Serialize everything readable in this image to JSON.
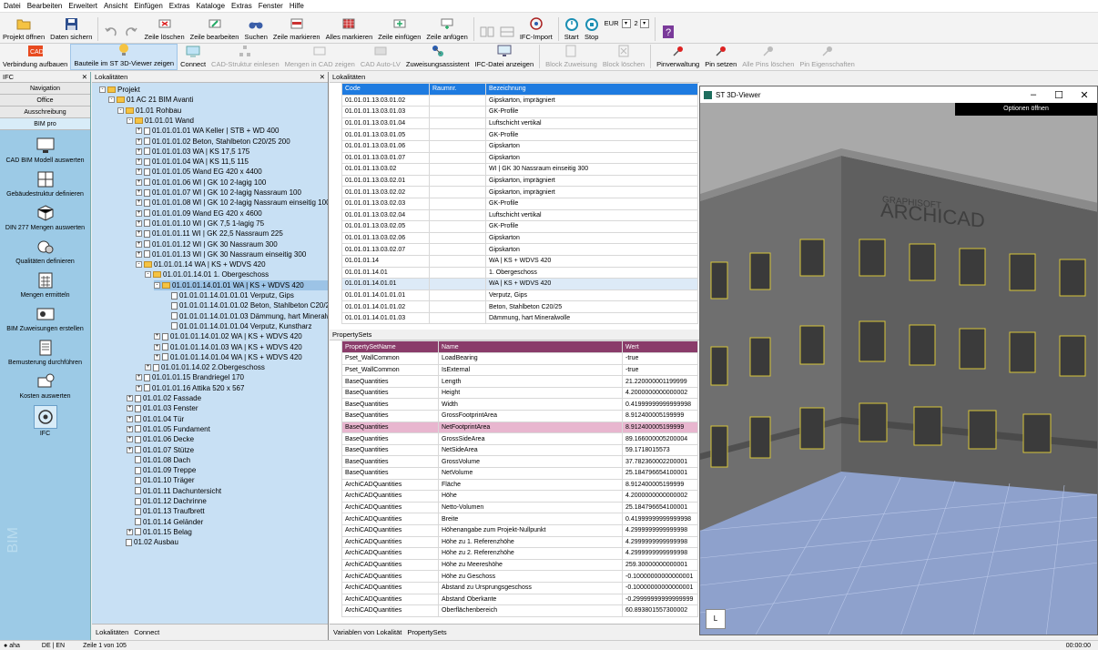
{
  "menu": [
    "Datei",
    "Bearbeiten",
    "Erweitert",
    "Ansicht",
    "Einfügen",
    "Extras",
    "Kataloge",
    "Extras",
    "Fenster",
    "Hilfe"
  ],
  "toolbar1": {
    "projekt_oeffnen": "Projekt öffnen",
    "daten_sichern": "Daten sichern",
    "zeile_loeschen": "Zeile löschen",
    "zeile_bearbeiten": "Zeile bearbeiten",
    "suchen": "Suchen",
    "zeile_markieren": "Zeile markieren",
    "alles_markieren": "Alles markieren",
    "zeile_einfuegen": "Zeile einfügen",
    "zeile_anfuegen": "Zeile anfügen",
    "ifc_import": "IFC-Import",
    "start": "Start",
    "stop": "Stop",
    "currency": "EUR",
    "decimals": "2"
  },
  "toolbar2": {
    "verbindung": "Verbindung aufbauen",
    "bauteile_3d": "Bauteile im ST 3D-Viewer zeigen",
    "connect": "Connect",
    "cad_struktur": "CAD-Struktur einlesen",
    "mengen_cad": "Mengen in CAD zeigen",
    "cad_auto_lv": "CAD Auto-LV",
    "zuweisungsassistent": "Zuweisungsassistent",
    "ifc_datei": "IFC-Datei anzeigen",
    "block_zuweisung": "Block Zuweisung",
    "block_loeschen": "Block löschen",
    "pinverwaltung": "Pinverwaltung",
    "pin_setzen": "Pin setzen",
    "alle_pins_loeschen": "Alle Pins löschen",
    "pin_eigenschaften": "Pin Eigenschaften"
  },
  "leftpanel": {
    "title": "IFC",
    "tabs": [
      "Navigation",
      "Office",
      "Ausschreibung",
      "BIM pro"
    ],
    "items": [
      "CAD BIM Modell auswerten",
      "Gebäudestruktur definieren",
      "DIN 277 Mengen auswerten",
      "Qualitäten definieren",
      "Mengen ermitteln",
      "BIM Zuweisungen erstellen",
      "Bemusterung durchführen",
      "Kosten auswerten",
      "IFC"
    ],
    "vertical_text": "BIM"
  },
  "tree": {
    "title": "Lokalitäten",
    "tabs": [
      "Lokalitäten",
      "Connect"
    ],
    "nodes": [
      {
        "d": 0,
        "t": "Projekt",
        "k": "fold",
        "pm": "-"
      },
      {
        "d": 1,
        "t": "01  AC 21 BIM Avanti",
        "k": "fold",
        "pm": "-"
      },
      {
        "d": 2,
        "t": "01.01  Rohbau",
        "k": "fold",
        "pm": "-"
      },
      {
        "d": 3,
        "t": "01.01.01  Wand",
        "k": "fold",
        "pm": "-"
      },
      {
        "d": 4,
        "t": "01.01.01.01  WA Keller | STB + WD 400",
        "k": "doc",
        "pm": "+"
      },
      {
        "d": 4,
        "t": "01.01.01.02  Beton, Stahlbeton C20/25 200",
        "k": "doc",
        "pm": "+"
      },
      {
        "d": 4,
        "t": "01.01.01.03  WA | KS 17,5 175",
        "k": "doc",
        "pm": "+"
      },
      {
        "d": 4,
        "t": "01.01.01.04  WA | KS 11,5 115",
        "k": "doc",
        "pm": "+"
      },
      {
        "d": 4,
        "t": "01.01.01.05  Wand EG 420 x 4400",
        "k": "doc",
        "pm": "+"
      },
      {
        "d": 4,
        "t": "01.01.01.06  WI | GK 10 2-lagig 100",
        "k": "doc",
        "pm": "+"
      },
      {
        "d": 4,
        "t": "01.01.01.07  WI | GK 10 2-lagig Nassraum 100",
        "k": "doc",
        "pm": "+"
      },
      {
        "d": 4,
        "t": "01.01.01.08  WI | GK 10 2-lagig Nassraum einseitig 100",
        "k": "doc",
        "pm": "+"
      },
      {
        "d": 4,
        "t": "01.01.01.09  Wand EG 420 x 4600",
        "k": "doc",
        "pm": "+"
      },
      {
        "d": 4,
        "t": "01.01.01.10  WI | GK 7,5 1-lagig 75",
        "k": "doc",
        "pm": "+"
      },
      {
        "d": 4,
        "t": "01.01.01.11  WI | GK 22,5 Nassraum 225",
        "k": "doc",
        "pm": "+"
      },
      {
        "d": 4,
        "t": "01.01.01.12  WI | GK 30 Nassraum 300",
        "k": "doc",
        "pm": "+"
      },
      {
        "d": 4,
        "t": "01.01.01.13  WI | GK 30 Nassraum einseitig 300",
        "k": "doc",
        "pm": "+"
      },
      {
        "d": 4,
        "t": "01.01.01.14  WA | KS + WDVS 420",
        "k": "fold",
        "pm": "-"
      },
      {
        "d": 5,
        "t": "01.01.01.14.01  1. Obergeschoss",
        "k": "fold",
        "pm": "-"
      },
      {
        "d": 6,
        "t": "01.01.01.14.01.01  WA | KS + WDVS 420",
        "k": "fold",
        "pm": "-",
        "sel": true
      },
      {
        "d": 7,
        "t": "01.01.01.14.01.01.01  Verputz, Gips",
        "k": "doc",
        "pm": ""
      },
      {
        "d": 7,
        "t": "01.01.01.14.01.01.02  Beton, Stahlbeton C20/25",
        "k": "doc",
        "pm": ""
      },
      {
        "d": 7,
        "t": "01.01.01.14.01.01.03  Dämmung, hart Mineralwo",
        "k": "doc",
        "pm": ""
      },
      {
        "d": 7,
        "t": "01.01.01.14.01.01.04  Verputz, Kunstharz",
        "k": "doc",
        "pm": ""
      },
      {
        "d": 6,
        "t": "01.01.01.14.01.02  WA | KS + WDVS 420",
        "k": "doc",
        "pm": "+"
      },
      {
        "d": 6,
        "t": "01.01.01.14.01.03  WA | KS + WDVS 420",
        "k": "doc",
        "pm": "+"
      },
      {
        "d": 6,
        "t": "01.01.01.14.01.04  WA | KS + WDVS 420",
        "k": "doc",
        "pm": "+"
      },
      {
        "d": 5,
        "t": "01.01.01.14.02  2.Obergeschoss",
        "k": "doc",
        "pm": "+"
      },
      {
        "d": 4,
        "t": "01.01.01.15  Brandriegel 170",
        "k": "doc",
        "pm": "+"
      },
      {
        "d": 4,
        "t": "01.01.01.16  Attika 520 x 567",
        "k": "doc",
        "pm": "+"
      },
      {
        "d": 3,
        "t": "01.01.02  Fassade",
        "k": "doc",
        "pm": "+"
      },
      {
        "d": 3,
        "t": "01.01.03  Fenster",
        "k": "doc",
        "pm": "+"
      },
      {
        "d": 3,
        "t": "01.01.04  Tür",
        "k": "doc",
        "pm": "+"
      },
      {
        "d": 3,
        "t": "01.01.05  Fundament",
        "k": "doc",
        "pm": "+"
      },
      {
        "d": 3,
        "t": "01.01.06  Decke",
        "k": "doc",
        "pm": "+"
      },
      {
        "d": 3,
        "t": "01.01.07  Stütze",
        "k": "doc",
        "pm": "+"
      },
      {
        "d": 3,
        "t": "01.01.08  Dach",
        "k": "doc",
        "pm": ""
      },
      {
        "d": 3,
        "t": "01.01.09  Treppe",
        "k": "doc",
        "pm": ""
      },
      {
        "d": 3,
        "t": "01.01.10  Träger",
        "k": "doc",
        "pm": ""
      },
      {
        "d": 3,
        "t": "01.01.11  Dachuntersicht",
        "k": "doc",
        "pm": ""
      },
      {
        "d": 3,
        "t": "01.01.12  Dachrinne",
        "k": "doc",
        "pm": ""
      },
      {
        "d": 3,
        "t": "01.01.13  Traufbrett",
        "k": "doc",
        "pm": ""
      },
      {
        "d": 3,
        "t": "01.01.14  Geländer",
        "k": "doc",
        "pm": ""
      },
      {
        "d": 3,
        "t": "01.01.15  Belag",
        "k": "doc",
        "pm": "+"
      },
      {
        "d": 2,
        "t": "01.02  Ausbau",
        "k": "doc",
        "pm": ""
      }
    ]
  },
  "lokalitaeten": {
    "title": "Lokalitäten",
    "columns": [
      "Code",
      "Raumnr.",
      "Bezeichnung"
    ],
    "rows": [
      [
        "01.01.01.13.03.01.02",
        "",
        "Gipskarton, imprägniert"
      ],
      [
        "01.01.01.13.03.01.03",
        "",
        "GK-Profile"
      ],
      [
        "01.01.01.13.03.01.04",
        "",
        "Luftschicht vertikal"
      ],
      [
        "01.01.01.13.03.01.05",
        "",
        "GK-Profile"
      ],
      [
        "01.01.01.13.03.01.06",
        "",
        "Gipskarton"
      ],
      [
        "01.01.01.13.03.01.07",
        "",
        "Gipskarton"
      ],
      [
        "01.01.01.13.03.02",
        "",
        "WI | GK 30 Nassraum einseitig 300"
      ],
      [
        "01.01.01.13.03.02.01",
        "",
        "Gipskarton, imprägniert"
      ],
      [
        "01.01.01.13.03.02.02",
        "",
        "Gipskarton, imprägniert"
      ],
      [
        "01.01.01.13.03.02.03",
        "",
        "GK-Profile"
      ],
      [
        "01.01.01.13.03.02.04",
        "",
        "Luftschicht vertikal"
      ],
      [
        "01.01.01.13.03.02.05",
        "",
        "GK-Profile"
      ],
      [
        "01.01.01.13.03.02.06",
        "",
        "Gipskarton"
      ],
      [
        "01.01.01.13.03.02.07",
        "",
        "Gipskarton"
      ],
      [
        "01.01.01.14",
        "",
        "WA | KS + WDVS 420"
      ],
      [
        "01.01.01.14.01",
        "",
        "1. Obergeschoss"
      ],
      [
        "01.01.01.14.01.01",
        "",
        "WA | KS + WDVS 420"
      ],
      [
        "01.01.01.14.01.01.01",
        "",
        "Verputz, Gips"
      ],
      [
        "01.01.01.14.01.01.02",
        "",
        "Beton, Stahlbeton C20/25"
      ],
      [
        "01.01.01.14.01.01.03",
        "",
        "Dämmung, hart Mineralwolle"
      ]
    ],
    "selected_index": 16
  },
  "propertysets": {
    "title": "PropertySets",
    "columns": [
      "PropertySetName",
      "Name",
      "Wert"
    ],
    "rows": [
      [
        "Pset_WallCommon",
        "LoadBearing",
        "-true"
      ],
      [
        "Pset_WallCommon",
        "IsExternal",
        "-true"
      ],
      [
        "BaseQuantities",
        "Length",
        "21.220000001199999"
      ],
      [
        "BaseQuantities",
        "Height",
        "4.2000000000000002"
      ],
      [
        "BaseQuantities",
        "Width",
        "0.41999999999999998"
      ],
      [
        "BaseQuantities",
        "GrossFootprintArea",
        "8.912400005199999"
      ],
      [
        "BaseQuantities",
        "NetFootprintArea",
        "8.912400005199999"
      ],
      [
        "BaseQuantities",
        "GrossSideArea",
        "89.166000005200004"
      ],
      [
        "BaseQuantities",
        "NetSideArea",
        "59.1718015573"
      ],
      [
        "BaseQuantities",
        "GrossVolume",
        "37.782360002200001"
      ],
      [
        "BaseQuantities",
        "NetVolume",
        "25.184796654100001"
      ],
      [
        "ArchiCADQuantities",
        "Fläche",
        "8.912400005199999"
      ],
      [
        "ArchiCADQuantities",
        "Höhe",
        "4.2000000000000002"
      ],
      [
        "ArchiCADQuantities",
        "Netto-Volumen",
        "25.184796654100001"
      ],
      [
        "ArchiCADQuantities",
        "Breite",
        "0.41999999999999998"
      ],
      [
        "ArchiCADQuantities",
        "Höhenangabe zum Projekt-Nullpunkt",
        "4.2999999999999998"
      ],
      [
        "ArchiCADQuantities",
        "Höhe zu 1. Referenzhöhe",
        "4.2999999999999998"
      ],
      [
        "ArchiCADQuantities",
        "Höhe zu 2. Referenzhöhe",
        "4.2999999999999998"
      ],
      [
        "ArchiCADQuantities",
        "Höhe zu Meereshöhe",
        "259.30000000000001"
      ],
      [
        "ArchiCADQuantities",
        "Höhe zu Geschoss",
        "-0.10000000000000001"
      ],
      [
        "ArchiCADQuantities",
        "Abstand zu Ursprungsgeschoss",
        "-0.10000000000000001"
      ],
      [
        "ArchiCADQuantities",
        "Abstand Oberkante",
        "-0.29999999999999999"
      ],
      [
        "ArchiCADQuantities",
        "Oberflächenbereich",
        "60.893801557300002"
      ]
    ],
    "selected_index": 6
  },
  "midtabs": [
    "Variablen von Lokalität",
    "PropertySets"
  ],
  "viewer": {
    "title": "ST 3D-Viewer",
    "options_button": "Optionen öffnen",
    "brand_line1": "GRAPHISOFT",
    "brand_line2": "ARCHICAD",
    "corner_icon": "L"
  },
  "status": {
    "user": "aha",
    "lang": "DE | EN",
    "line": "Zeile 1 von 105",
    "time": "00:00:00"
  },
  "colors": {
    "lok_header": "#1e7be0",
    "prop_header": "#8a3c6a",
    "tree_bg": "#c8e0f4",
    "left_bg": "#9ccae6",
    "selected_row": "#e8b6cf"
  }
}
